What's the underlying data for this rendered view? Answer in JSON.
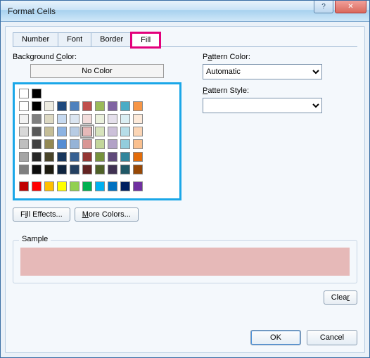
{
  "title": "Format Cells",
  "tabs": [
    {
      "label": "Number"
    },
    {
      "label": "Font"
    },
    {
      "label": "Border"
    },
    {
      "label": "Fill"
    }
  ],
  "active_tab_index": 3,
  "left": {
    "bgcolor_label": "Background Color:",
    "bgcolor_underline_char": "C",
    "nocolor_label": "No Color",
    "fill_effects_label": "Fill Effects...",
    "more_colors_label": "More Colors..."
  },
  "right": {
    "pattern_color_label": "Pattern Color:",
    "pattern_color_value": "Automatic",
    "pattern_style_label": "Pattern Style:",
    "pattern_style_value": ""
  },
  "sample": {
    "label": "Sample",
    "color": "#e6b9b8"
  },
  "buttons": {
    "clear": "Clear",
    "ok": "OK",
    "cancel": "Cancel"
  },
  "palette": {
    "auto_row": [
      "#ffffff",
      "#000000"
    ],
    "theme_row": [
      "#ffffff",
      "#000000",
      "#eeece1",
      "#1f497d",
      "#4f81bd",
      "#c0504d",
      "#9bbb59",
      "#8064a2",
      "#4bacc6",
      "#f79646"
    ],
    "tints": [
      [
        "#f2f2f2",
        "#7f7f7f",
        "#ddd9c3",
        "#c6d9f0",
        "#dbe5f1",
        "#f2dcdb",
        "#ebf1dd",
        "#e5e0ec",
        "#dbeef3",
        "#fdeada"
      ],
      [
        "#d8d8d8",
        "#595959",
        "#c4bd97",
        "#8db3e2",
        "#b8cce4",
        "#e6b9b8",
        "#d7e3bc",
        "#ccc1d9",
        "#b7dde8",
        "#fbd5b5"
      ],
      [
        "#bfbfbf",
        "#3f3f3f",
        "#938953",
        "#548dd4",
        "#95b3d7",
        "#d99694",
        "#c3d69b",
        "#b2a2c7",
        "#92cddc",
        "#fac08f"
      ],
      [
        "#a5a5a5",
        "#262626",
        "#494429",
        "#17365d",
        "#366092",
        "#953734",
        "#76923c",
        "#5f497a",
        "#31859b",
        "#e36c09"
      ],
      [
        "#7f7f7f",
        "#0c0c0c",
        "#1d1b10",
        "#0f243e",
        "#244061",
        "#632423",
        "#4f6128",
        "#3f3151",
        "#205867",
        "#974806"
      ]
    ],
    "standard": [
      "#c00000",
      "#ff0000",
      "#ffc000",
      "#ffff00",
      "#92d050",
      "#00b050",
      "#00b0f0",
      "#0070c0",
      "#002060",
      "#7030a0"
    ],
    "selected": "#e6b9b8"
  }
}
